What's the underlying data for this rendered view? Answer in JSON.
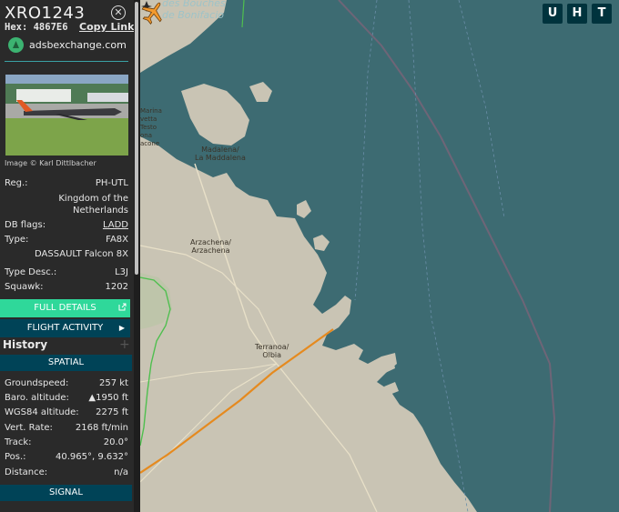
{
  "map": {
    "sea_label": "des Bouches\nde Bonifacio",
    "places": [
      {
        "name": "Madalena/\nLa Maddalena"
      },
      {
        "name": "Arzachena/\nArzachena"
      },
      {
        "name": "Terranoa/\nOlbia"
      },
      {
        "name": "Marina\nvetta\nTesto\nona\nacone"
      }
    ],
    "buttons": [
      "U",
      "H",
      "T"
    ],
    "colors": {
      "sea": "#3d6b72",
      "land": "#c9c4b4",
      "track": "#e58a1f",
      "plane": "#f29a2e"
    }
  },
  "aircraft": {
    "callsign": "XRO1243",
    "hex_label": "Hex: 4867E6",
    "copy_link": "Copy Link",
    "source": "adsbexchange.com",
    "photo_credit": "Image © Karl Dittlbacher"
  },
  "details": {
    "reg_label": "Reg.:",
    "reg_value": "PH-UTL",
    "country": "Kingdom of the\nNetherlands",
    "dbflags_label": "DB flags:",
    "dbflags_value": "LADD",
    "type_label": "Type:",
    "type_value": "FA8X",
    "type_name": "DASSAULT Falcon 8X",
    "typedesc_label": "Type Desc.:",
    "typedesc_value": "L3J",
    "squawk_label": "Squawk:",
    "squawk_value": "1202"
  },
  "buttons": {
    "full_details": "FULL DETAILS",
    "flight_activity": "FLIGHT ACTIVITY"
  },
  "history": {
    "title": "History",
    "plus": "+"
  },
  "spatial": {
    "title": "SPATIAL",
    "groundspeed_label": "Groundspeed:",
    "groundspeed_value": "257 kt",
    "baro_label": "Baro. altitude:",
    "baro_value": "▲1950 ft",
    "wgs_label": "WGS84 altitude:",
    "wgs_value": "2275 ft",
    "vrate_label": "Vert. Rate:",
    "vrate_value": "2168 ft/min",
    "track_label": "Track:",
    "track_value": "20.0°",
    "pos_label": "Pos.:",
    "pos_value": "40.965°, 9.632°",
    "distance_label": "Distance:",
    "distance_value": "n/a"
  },
  "signal": {
    "title": "SIGNAL"
  }
}
